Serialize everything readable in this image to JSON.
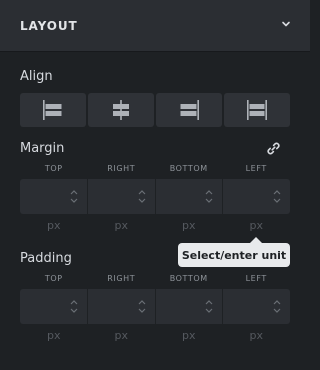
{
  "panel": {
    "title": "LAYOUT"
  },
  "align": {
    "label": "Align",
    "options": [
      "align-left",
      "align-center",
      "align-right",
      "stretch"
    ]
  },
  "margin": {
    "label": "Margin",
    "columns": [
      "TOP",
      "RIGHT",
      "BOTTOM",
      "LEFT"
    ],
    "values": [
      "",
      "",
      "",
      ""
    ],
    "units": [
      "px",
      "px",
      "px",
      "px"
    ],
    "link_icon": "link-icon"
  },
  "padding": {
    "label": "Padding",
    "columns": [
      "TOP",
      "RIGHT",
      "BOTTOM",
      "LEFT"
    ],
    "values": [
      "",
      "",
      "",
      ""
    ],
    "units": [
      "px",
      "px",
      "px",
      "px"
    ]
  },
  "tooltip": {
    "text": "Select/enter unit"
  },
  "colors": {
    "background": "#1e2124",
    "header": "#2b2e33",
    "control": "#2f3237",
    "tooltip": "#e8eaec"
  }
}
